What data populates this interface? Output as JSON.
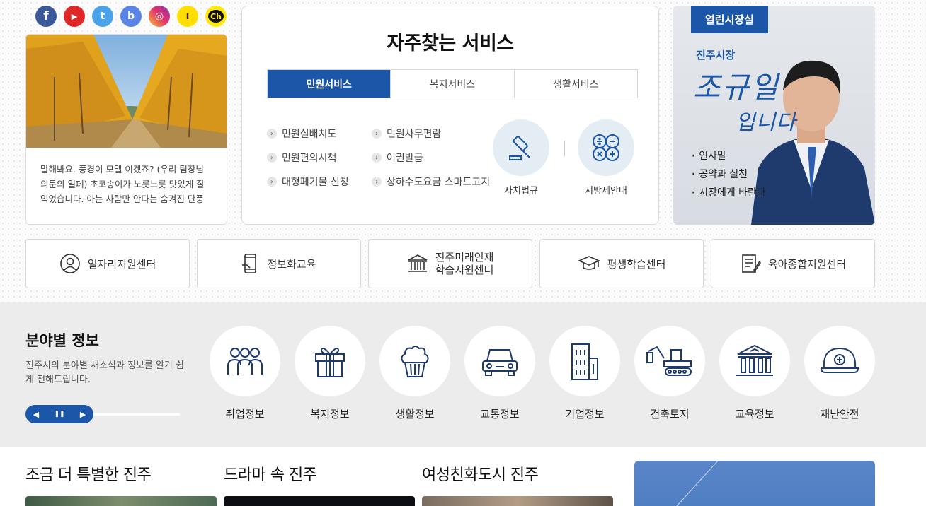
{
  "social": [
    "facebook-icon",
    "youtube-icon",
    "twitter-icon",
    "band-icon",
    "instagram-icon",
    "kakaostory-icon",
    "kakao-channel-icon"
  ],
  "social_glyphs": {
    "fb": "f",
    "yt": "▶",
    "tw": "t",
    "bd": "b",
    "ig": "◎",
    "ks": "ı",
    "ch": "Ch"
  },
  "photo_card": {
    "caption": "말해봐요. 풍경이 모델 이겠죠? (우리 팀장님 의문의 일페) 초코송이가 노릇노릇 맛있게 잘 익었습니다. 아는 사람만 안다는 숨겨진 단풍"
  },
  "fav": {
    "title": "자주찾는 서비스",
    "tabs": [
      "민원서비스",
      "복지서비스",
      "생활서비스"
    ],
    "active_tab": 0,
    "links": [
      "민원실배치도",
      "민원사무편람",
      "민원편의시책",
      "여권발급",
      "대형폐기물 신청",
      "상하수도요금 스마트고지"
    ],
    "quick": [
      {
        "label": "자치법규",
        "icon": "gavel-icon"
      },
      {
        "label": "지방세안내",
        "icon": "calculator-icon"
      }
    ]
  },
  "mayor": {
    "badge": "열린시장실",
    "subtitle": "진주시장",
    "name": "조규일",
    "suffix": "입니다",
    "menu": [
      "인사말",
      "공약과 실천",
      "시장에게 바란다"
    ]
  },
  "centers": [
    {
      "label": "일자리지원센터",
      "icon": "person-icon"
    },
    {
      "label": "정보화교육",
      "icon": "mobile-icon"
    },
    {
      "label_line1": "진주미래인재",
      "label_line2": "학습지원센터",
      "icon": "building-icon"
    },
    {
      "label": "평생학습센터",
      "icon": "graduation-cap-icon"
    },
    {
      "label": "육아종합지원센터",
      "icon": "document-icon"
    }
  ],
  "field": {
    "title": "분야별 정보",
    "desc": "진주시의 분야별 새소식과 정보를 알기 쉽게 전해드립니다.",
    "controls": {
      "prev": "◀",
      "pause": "❚❚",
      "next": "▶"
    },
    "items": [
      {
        "label": "취업정보",
        "icon": "people-icon"
      },
      {
        "label": "복지정보",
        "icon": "gift-icon"
      },
      {
        "label": "생활정보",
        "icon": "cupcake-icon"
      },
      {
        "label": "교통정보",
        "icon": "car-icon"
      },
      {
        "label": "기업정보",
        "icon": "office-building-icon"
      },
      {
        "label": "건축토지",
        "icon": "excavator-icon"
      },
      {
        "label": "교육정보",
        "icon": "institution-icon"
      },
      {
        "label": "재난안전",
        "icon": "helmet-icon"
      }
    ]
  },
  "bottom": {
    "titles": [
      "조금 더 특별한 진주",
      "드라마 속 진주",
      "여성친화도시 진주"
    ]
  },
  "colors": {
    "brand": "#1b56a8",
    "quick_circle": "#e4edf4",
    "field_bg": "#ececec"
  }
}
